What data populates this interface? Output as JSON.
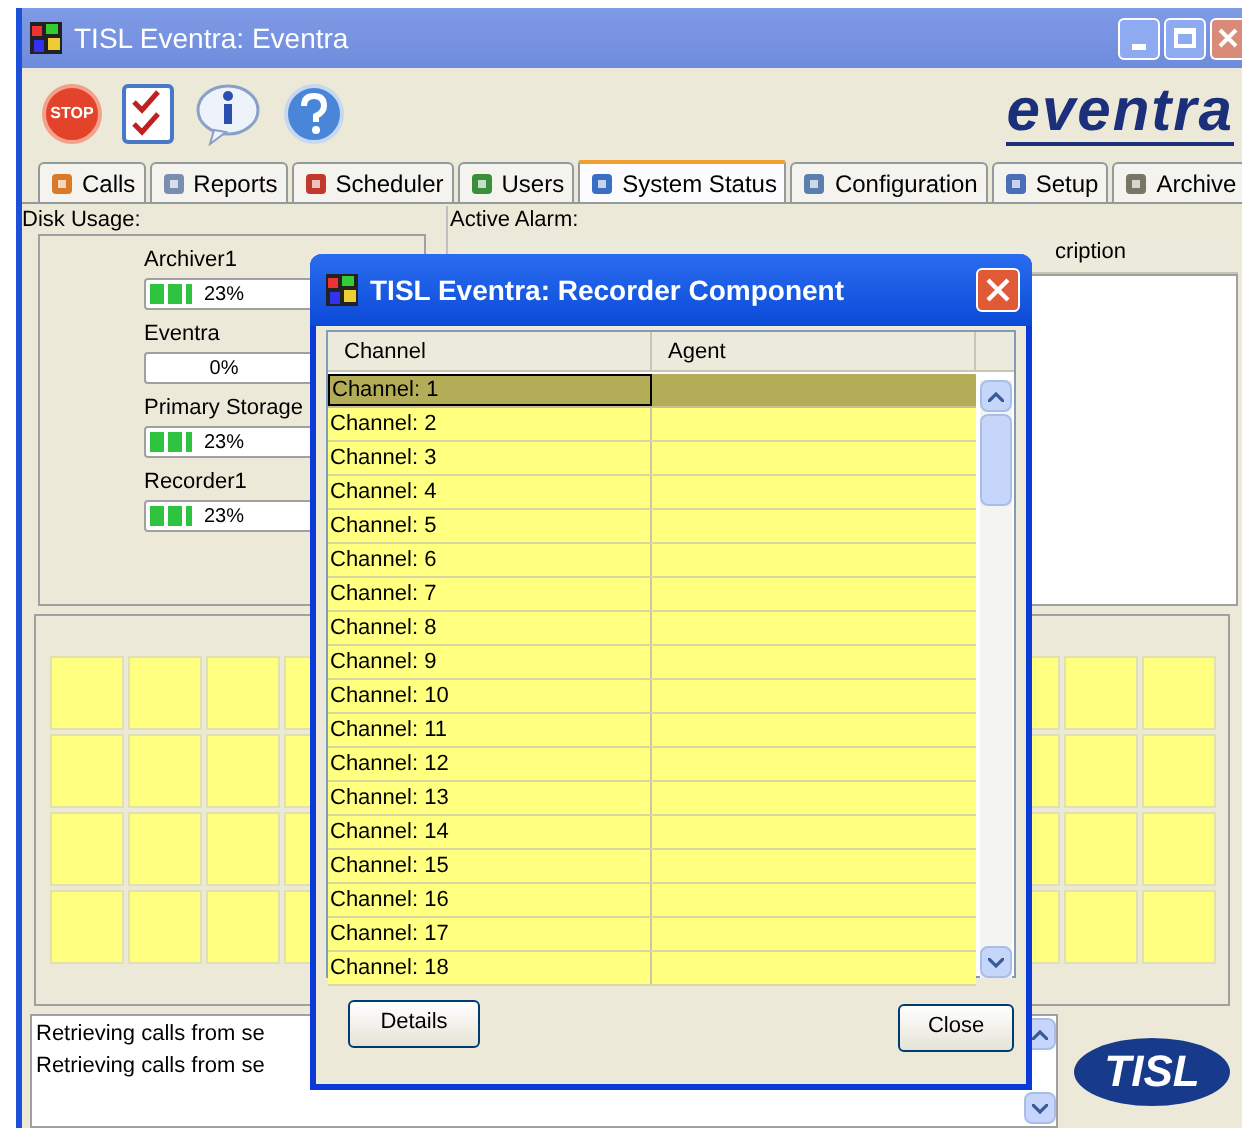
{
  "window": {
    "title": "TISL Eventra: Eventra"
  },
  "toolbar": {
    "stop_label": "STOP",
    "logo": "eventra"
  },
  "tabs": [
    {
      "label": "Calls",
      "selected": false
    },
    {
      "label": "Reports",
      "selected": false
    },
    {
      "label": "Scheduler",
      "selected": false
    },
    {
      "label": "Users",
      "selected": false
    },
    {
      "label": "System Status",
      "selected": true
    },
    {
      "label": "Configuration",
      "selected": false
    },
    {
      "label": "Setup",
      "selected": false
    },
    {
      "label": "Archive",
      "selected": false
    }
  ],
  "disk_usage": {
    "title": "Disk Usage:",
    "disks": [
      {
        "name": "Archiver1",
        "level": 0.23,
        "reading": "23%"
      },
      {
        "name": "Eventra",
        "level": 0,
        "reading": "0%"
      },
      {
        "name": "Primary Storage",
        "level": 0.23,
        "reading": "23%"
      },
      {
        "name": "Recorder1",
        "level": 0.23,
        "reading": "23%"
      }
    ]
  },
  "active_alarm": {
    "title": "Active Alarm:",
    "columns": [
      "cription"
    ]
  },
  "log": {
    "lines": [
      "Retrieving calls from se",
      "Retrieving calls from se"
    ]
  },
  "brand_logo": "TISL",
  "dialog": {
    "title": "TISL Eventra: Recorder Component",
    "columns": [
      "Channel",
      "Agent"
    ],
    "rows": [
      {
        "channel": "Channel: 1",
        "selected": true
      },
      {
        "channel": "Channel: 2",
        "selected": false
      },
      {
        "channel": "Channel: 3",
        "selected": false
      },
      {
        "channel": "Channel: 4",
        "selected": false
      },
      {
        "channel": "Channel: 5",
        "selected": false
      },
      {
        "channel": "Channel: 6",
        "selected": false
      },
      {
        "channel": "Channel: 7",
        "selected": false
      },
      {
        "channel": "Channel: 8",
        "selected": false
      },
      {
        "channel": "Channel: 9",
        "selected": false
      },
      {
        "channel": "Channel: 10",
        "selected": false
      },
      {
        "channel": "Channel: 11",
        "selected": false
      },
      {
        "channel": "Channel: 12",
        "selected": false
      },
      {
        "channel": "Channel: 13",
        "selected": false
      },
      {
        "channel": "Channel: 14",
        "selected": false
      },
      {
        "channel": "Channel: 15",
        "selected": false
      },
      {
        "channel": "Channel: 16",
        "selected": false
      },
      {
        "channel": "Channel: 17",
        "selected": false
      },
      {
        "channel": "Channel: 18",
        "selected": false
      }
    ],
    "buttons": [
      "Details",
      "Close"
    ]
  }
}
